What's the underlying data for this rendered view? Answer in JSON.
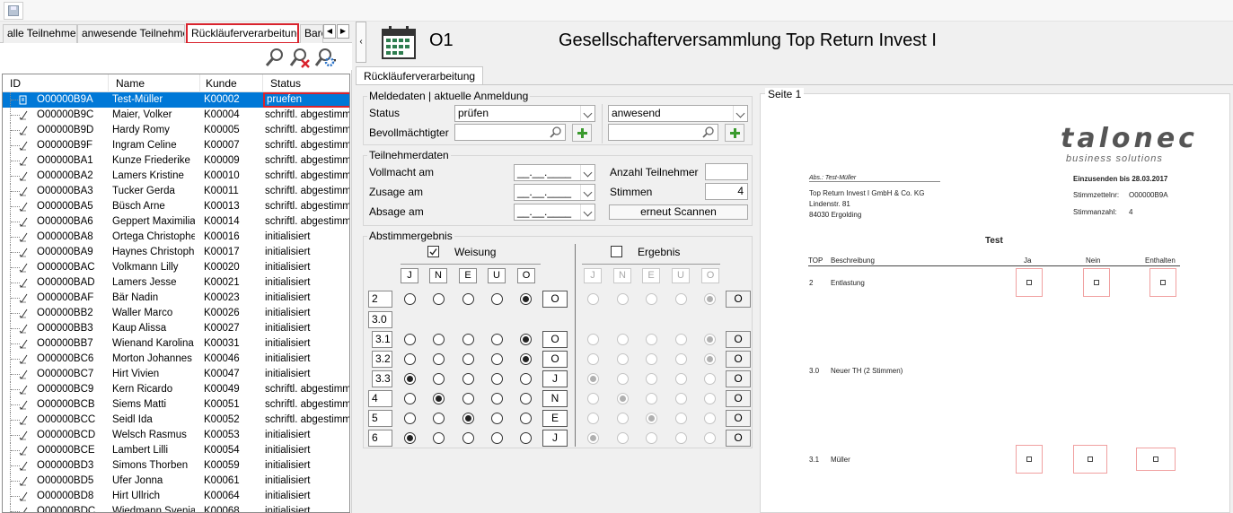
{
  "left_tabs": [
    "alle Teilnehmer",
    "anwesende Teilnehmer",
    "Rückläuferverarbeitung",
    "Barc"
  ],
  "grid": {
    "headers": [
      "ID",
      "Name",
      "Kunde",
      "Status"
    ],
    "rows": [
      {
        "id": "O00000B9A",
        "name": "Test-Müller",
        "kunde": "K00002",
        "status": "pruefen"
      },
      {
        "id": "O00000B9C",
        "name": "Maier, Volker",
        "kunde": "K00004",
        "status": "schriftl. abgestimmt"
      },
      {
        "id": "O00000B9D",
        "name": "Hardy Romy",
        "kunde": "K00005",
        "status": "schriftl. abgestimmt"
      },
      {
        "id": "O00000B9F",
        "name": "Ingram Celine",
        "kunde": "K00007",
        "status": "schriftl. abgestimmt"
      },
      {
        "id": "O00000BA1",
        "name": "Kunze Friederike",
        "kunde": "K00009",
        "status": "schriftl. abgestimmt"
      },
      {
        "id": "O00000BA2",
        "name": "Lamers Kristine",
        "kunde": "K00010",
        "status": "schriftl. abgestimmt"
      },
      {
        "id": "O00000BA3",
        "name": "Tucker Gerda",
        "kunde": "K00011",
        "status": "schriftl. abgestimmt"
      },
      {
        "id": "O00000BA5",
        "name": "Büsch Arne",
        "kunde": "K00013",
        "status": "schriftl. abgestimmt"
      },
      {
        "id": "O00000BA6",
        "name": "Geppert Maximilian",
        "kunde": "K00014",
        "status": "schriftl. abgestimmt"
      },
      {
        "id": "O00000BA8",
        "name": "Ortega Christopher",
        "kunde": "K00016",
        "status": "initialisiert"
      },
      {
        "id": "O00000BA9",
        "name": "Haynes Christoph",
        "kunde": "K00017",
        "status": "initialisiert"
      },
      {
        "id": "O00000BAC",
        "name": "Volkmann Lilly",
        "kunde": "K00020",
        "status": "initialisiert"
      },
      {
        "id": "O00000BAD",
        "name": "Lamers Jesse",
        "kunde": "K00021",
        "status": "initialisiert"
      },
      {
        "id": "O00000BAF",
        "name": "Bär Nadin",
        "kunde": "K00023",
        "status": "initialisiert"
      },
      {
        "id": "O00000BB2",
        "name": "Waller Marco",
        "kunde": "K00026",
        "status": "initialisiert"
      },
      {
        "id": "O00000BB3",
        "name": "Kaup Alissa",
        "kunde": "K00027",
        "status": "initialisiert"
      },
      {
        "id": "O00000BB7",
        "name": "Wienand Karolina",
        "kunde": "K00031",
        "status": "initialisiert"
      },
      {
        "id": "O00000BC6",
        "name": "Morton Johannes",
        "kunde": "K00046",
        "status": "initialisiert"
      },
      {
        "id": "O00000BC7",
        "name": "Hirt Vivien",
        "kunde": "K00047",
        "status": "initialisiert"
      },
      {
        "id": "O00000BC9",
        "name": "Kern Ricardo",
        "kunde": "K00049",
        "status": "schriftl. abgestimmt"
      },
      {
        "id": "O00000BCB",
        "name": "Siems Matti",
        "kunde": "K00051",
        "status": "schriftl. abgestimmt"
      },
      {
        "id": "O00000BCC",
        "name": "Seidl Ida",
        "kunde": "K00052",
        "status": "schriftl. abgestimmt"
      },
      {
        "id": "O00000BCD",
        "name": "Welsch Rasmus",
        "kunde": "K00053",
        "status": "initialisiert"
      },
      {
        "id": "O00000BCE",
        "name": "Lambert Lilli",
        "kunde": "K00054",
        "status": "initialisiert"
      },
      {
        "id": "O00000BD3",
        "name": "Simons Thorben",
        "kunde": "K00059",
        "status": "initialisiert"
      },
      {
        "id": "O00000BD5",
        "name": "Ufer Jonna",
        "kunde": "K00061",
        "status": "initialisiert"
      },
      {
        "id": "O00000BD8",
        "name": "Hirt Ullrich",
        "kunde": "K00064",
        "status": "initialisiert"
      },
      {
        "id": "O00000BDC",
        "name": "Wiedmann Svenja",
        "kunde": "K00068",
        "status": "initialisiert"
      }
    ]
  },
  "header": {
    "code": "O1",
    "title": "Gesellschafterversammlung Top Return Invest I"
  },
  "right_tab": "Rückläuferverarbeitung",
  "meldedaten": {
    "legend": "Meldedaten | aktuelle Anmeldung",
    "status_label": "Status",
    "status_value": "prüfen",
    "presence_value": "anwesend",
    "bevoll_label": "Bevollmächtigter"
  },
  "teilnehmer": {
    "legend": "Teilnehmerdaten",
    "vollmacht_label": "Vollmacht am",
    "zusage_label": "Zusage am",
    "absage_label": "Absage am",
    "date_placeholder": "__.__.____",
    "anzahl_label": "Anzahl Teilnehmer",
    "anzahl_value": "",
    "stimmen_label": "Stimmen",
    "stimmen_value": "4",
    "rescan_label": "erneut Scannen"
  },
  "abstimm": {
    "legend": "Abstimmergebnis",
    "weisung_label": "Weisung",
    "ergebnis_label": "Ergebnis",
    "letters": [
      "J",
      "N",
      "E",
      "U",
      "O"
    ],
    "rows": [
      {
        "top": "2",
        "sel": 4,
        "val": "O",
        "res": "O"
      },
      {
        "top": "3.0",
        "sel": -1,
        "val": "",
        "res": ""
      },
      {
        "top": "3.1",
        "sel": 4,
        "val": "O",
        "res": "O"
      },
      {
        "top": "3.2",
        "sel": 4,
        "val": "O",
        "res": "O"
      },
      {
        "top": "3.3",
        "sel": 0,
        "val": "J",
        "res": "O"
      },
      {
        "top": "4",
        "sel": 1,
        "val": "N",
        "res": "O"
      },
      {
        "top": "5",
        "sel": 2,
        "val": "E",
        "res": "O"
      },
      {
        "top": "6",
        "sel": 0,
        "val": "J",
        "res": "O"
      }
    ]
  },
  "preview": {
    "legend": "Seite 1",
    "logo_main": "talonec",
    "logo_sub": "business solutions",
    "abs": "Abs.: Test-Müller",
    "addr1": "Top Return Invest I GmbH & Co. KG",
    "addr2": "Lindenstr. 81",
    "addr3": "84030 Ergolding",
    "einsenden": "Einzusenden bis 28.03.2017",
    "stimmzettel_label": "Stimmzettelnr:",
    "stimmzettel_value": "O00000B9A",
    "stimmanzahl_label": "Stimmanzahl:",
    "stimmanzahl_value": "4",
    "doc_title": "Test",
    "col_top": "TOP",
    "col_desc": "Beschreibung",
    "col_ja": "Ja",
    "col_nein": "Nein",
    "col_enth": "Enthalten",
    "item1_top": "2",
    "item1_desc": "Entlastung",
    "item2_top": "3.0",
    "item2_desc": "Neuer TH (2 Stimmen)",
    "item3_top": "3.1",
    "item3_desc": "Müller"
  },
  "colors": {
    "selection": "#0078d7",
    "highlight": "#d9232d",
    "plus": "#3a9a2e"
  }
}
